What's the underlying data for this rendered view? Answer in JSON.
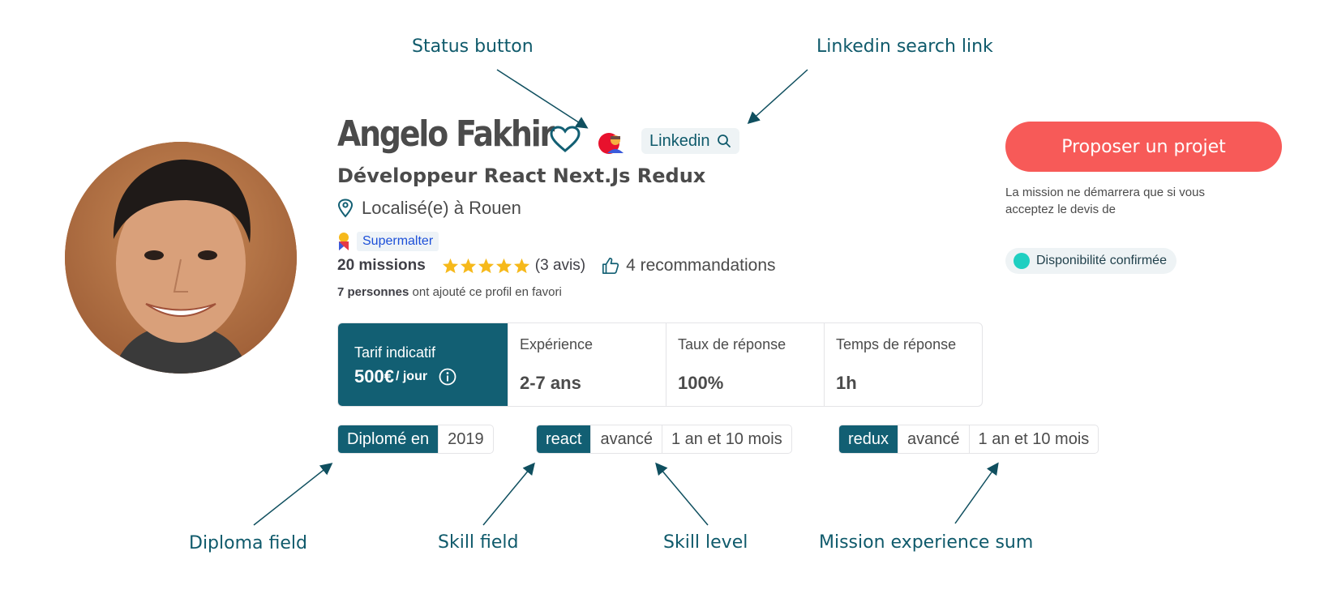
{
  "annotations": {
    "status_button": "Status button",
    "linkedin_search": "Linkedin search link",
    "diploma_field": "Diploma field",
    "skill_field": "Skill field",
    "skill_level": "Skill level",
    "mission_experience": "Mission experience sum"
  },
  "profile": {
    "name": "Angelo Fakhir",
    "title": "Développeur React Next.Js Redux",
    "location": "Localisé(e) à Rouen",
    "badge": "Supermalter",
    "missions": "20 missions",
    "rating": 5,
    "reviews": "(3 avis)",
    "recommendations": "4 recommandations",
    "favorites_count": "7 personnes",
    "favorites_text": "ont ajouté ce profil en favori",
    "linkedin_label": "Linkedin"
  },
  "rates": {
    "tarif_label": "Tarif indicatif",
    "tarif_value": "500€",
    "tarif_unit": "/ jour",
    "experience_label": "Expérience",
    "experience_value": "2-7 ans",
    "response_rate_label": "Taux de réponse",
    "response_rate_value": "100%",
    "response_time_label": "Temps de réponse",
    "response_time_value": "1h"
  },
  "diploma": {
    "label": "Diplomé en",
    "year": "2019"
  },
  "skills": [
    {
      "name": "react",
      "level": "avancé",
      "duration": "1 an et 10 mois"
    },
    {
      "name": "redux",
      "level": "avancé",
      "duration": "1 an et 10 mois"
    }
  ],
  "actions": {
    "propose_label": "Proposer un projet",
    "mission_note": "La mission ne démarrera que si vous acceptez le devis de",
    "availability": "Disponibilité confirmée"
  },
  "colors": {
    "primary": "#125f73",
    "cta": "#f75a58",
    "availability_dot": "#1fcfc1",
    "star": "#f6b91b"
  }
}
